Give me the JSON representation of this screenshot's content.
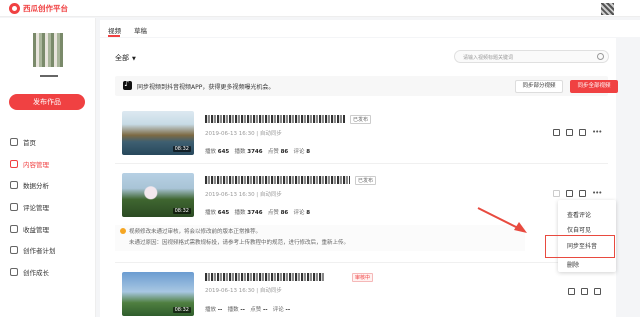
{
  "app": {
    "name": "西瓜创作平台"
  },
  "tabs": [
    {
      "label": "视频"
    },
    {
      "label": "草稿"
    }
  ],
  "sidebar": {
    "username": "■_",
    "publish_label": "发布作品",
    "items": [
      {
        "label": "首页",
        "icon": "home-icon"
      },
      {
        "label": "内容管理",
        "icon": "content-icon",
        "active": true
      },
      {
        "label": "数据分析",
        "icon": "chart-icon"
      },
      {
        "label": "评论管理",
        "icon": "comment-icon"
      },
      {
        "label": "收益管理",
        "icon": "wallet-icon"
      },
      {
        "label": "创作者计划",
        "icon": "plan-icon"
      },
      {
        "label": "创作成长",
        "icon": "growth-icon"
      }
    ]
  },
  "filter": {
    "label": "全部"
  },
  "search": {
    "placeholder": "请输入视频标题关键词"
  },
  "banner": {
    "text": "同步视频到抖音视频APP，获得更多视频曝光机会。",
    "partial_label": "同步部分视频",
    "all_label": "同步全部视频"
  },
  "videos": [
    {
      "duration": "08:32",
      "badge": "已发布",
      "date": "2019-06-13 16:30",
      "source": "自动同步",
      "plays_label": "播放",
      "plays": "645",
      "impr_label": "播数",
      "impr": "3746",
      "likes_label": "点赞",
      "likes": "86",
      "comments_label": "评论",
      "comments": "8"
    },
    {
      "duration": "08:32",
      "badge": "已发布",
      "date": "2019-06-13 16:30",
      "source": "自动同步",
      "plays_label": "播放",
      "plays": "645",
      "impr_label": "播数",
      "impr": "3746",
      "likes_label": "点赞",
      "likes": "86",
      "comments_label": "评论",
      "comments": "8"
    },
    {
      "duration": "08:32",
      "badge": "审核中",
      "date": "2019-06-13 16:30",
      "source": "自动同步",
      "plays_label": "播放",
      "plays": "--",
      "impr_label": "播数",
      "impr": "--",
      "likes_label": "点赞",
      "likes": "--",
      "comments_label": "评论",
      "comments": "--"
    }
  ],
  "notice": {
    "line1": "视频修改未通过审核，将会以修改前的版本正常推荐。",
    "line2": "未通过原因：因视频格式需教规标投，请参考上传教程中的规范，进行修改后，重新上传。"
  },
  "dropdown": {
    "items": [
      "查看评论",
      "仅自可见",
      "同步至抖音",
      "删除"
    ],
    "highlighted_index": 2
  },
  "colors": {
    "brand": "#f04142",
    "annotation": "#e84a3f"
  }
}
